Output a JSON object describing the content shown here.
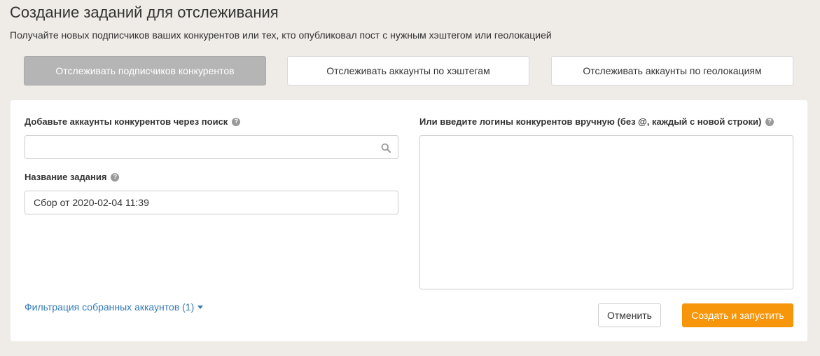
{
  "header": {
    "title": "Создание заданий для отслеживания",
    "subtitle": "Получайте новых подписчиков ваших конкурентов или тех, кто опубликовал пост с нужным хэштегом или геолокацией"
  },
  "tabs": [
    {
      "label": "Отслеживать подписчиков конкурентов",
      "active": true
    },
    {
      "label": "Отслеживать аккаунты по хэштегам",
      "active": false
    },
    {
      "label": "Отслеживать аккаунты по геолокациям",
      "active": false
    }
  ],
  "form": {
    "search_label": "Добавьте аккаунты конкурентов через поиск",
    "search_value": "",
    "search_placeholder": "",
    "name_label": "Название задания",
    "name_value": "Сбор от 2020-02-04 11:39",
    "manual_label": "Или введите логины конкурентов вручную (без @, каждый с новой строки)",
    "manual_value": "",
    "help_glyph": "?",
    "filter_link": "Фильтрация собранных аккаунтов (1)"
  },
  "actions": {
    "cancel_label": "Отменить",
    "create_label": "Создать и запустить"
  },
  "colors": {
    "background": "#efebe7",
    "accent": "#f7960a",
    "link": "#337ab7",
    "active_tab": "#b5b5b5"
  }
}
